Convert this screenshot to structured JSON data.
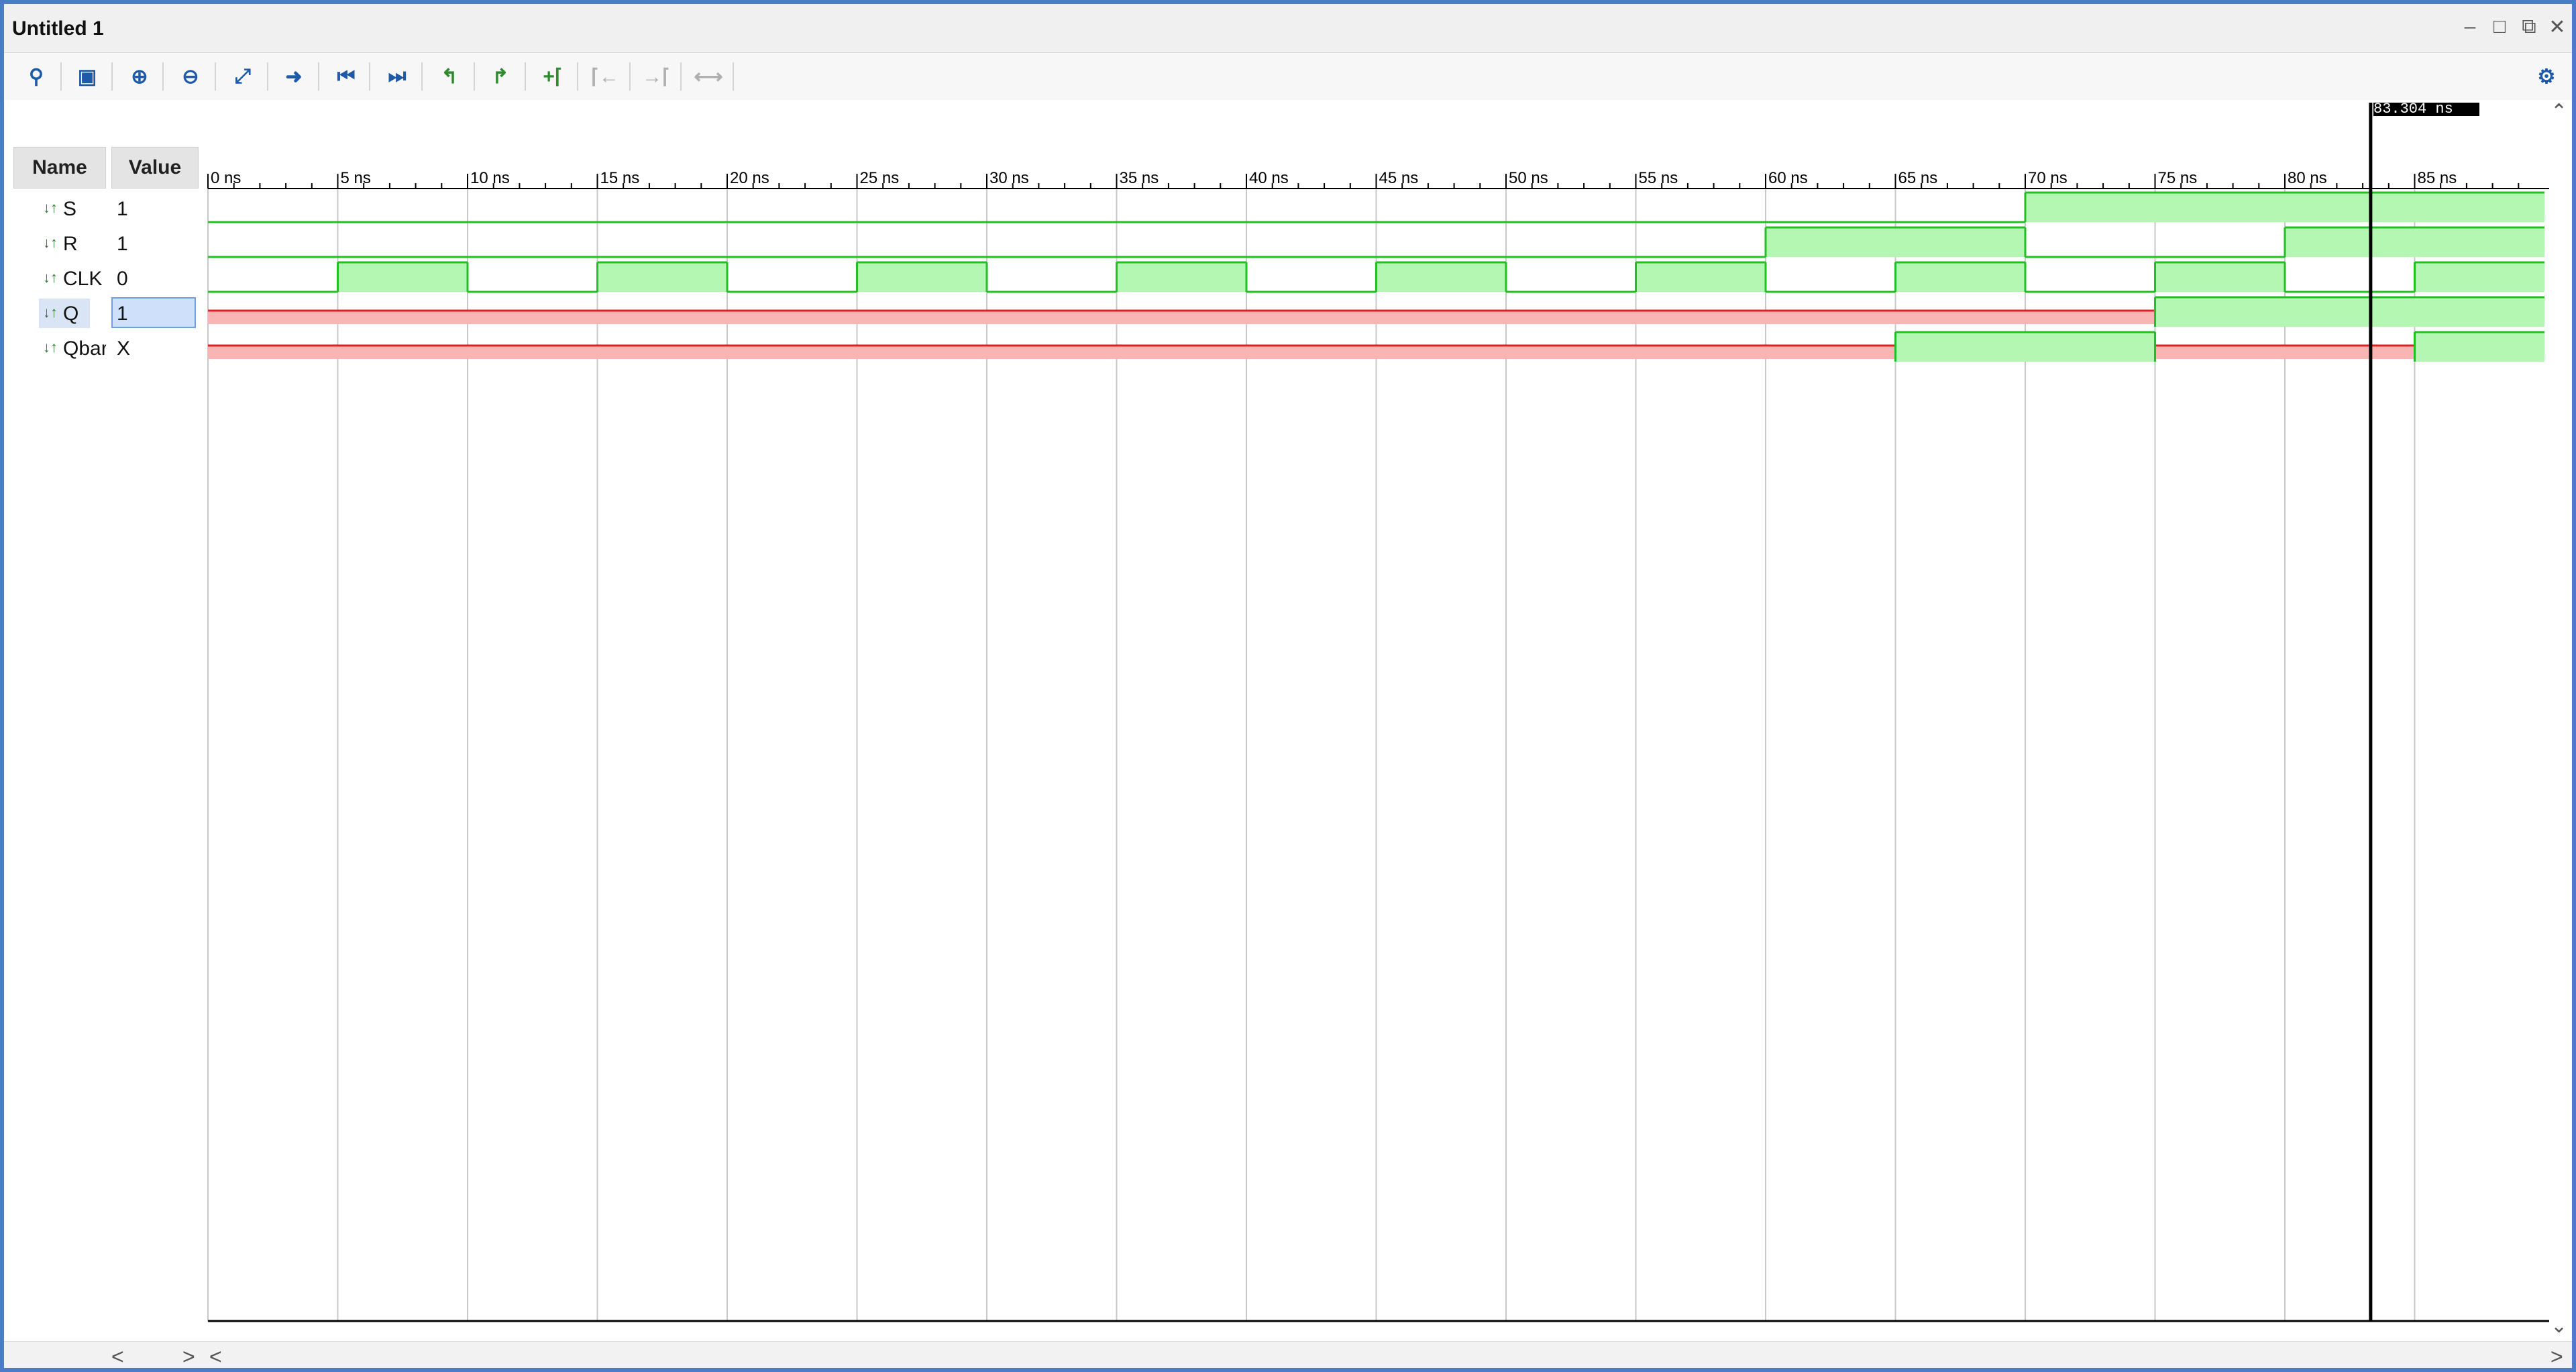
{
  "window": {
    "title": "Untitled 1"
  },
  "toolbar": {
    "buttons": [
      {
        "icon": "search-icon"
      },
      {
        "icon": "save-icon"
      },
      {
        "icon": "zoom-in-icon"
      },
      {
        "icon": "zoom-out-icon"
      },
      {
        "icon": "zoom-fit-icon"
      },
      {
        "icon": "go-to-cursor-icon"
      },
      {
        "icon": "go-to-start-icon"
      },
      {
        "icon": "go-to-end-icon"
      },
      {
        "icon": "previous-transition-icon"
      },
      {
        "icon": "next-transition-icon"
      },
      {
        "icon": "add-marker-icon"
      },
      {
        "icon": "previous-marker-icon"
      },
      {
        "icon": "next-marker-icon"
      },
      {
        "icon": "swap-cursors-icon"
      }
    ],
    "settings_icon": "gear-icon"
  },
  "columns": {
    "name": "Name",
    "value": "Value"
  },
  "signals": [
    {
      "name": "S",
      "value": "1"
    },
    {
      "name": "R",
      "value": "1"
    },
    {
      "name": "CLK",
      "value": "0"
    },
    {
      "name": "Q",
      "value": "1"
    },
    {
      "name": "Qbar",
      "value": "X"
    }
  ],
  "timeline": {
    "unit": "ns",
    "ticks": [
      "0 ns",
      "5 ns",
      "10 ns",
      "15 ns",
      "20 ns",
      "25 ns",
      "30 ns",
      "35 ns",
      "40 ns",
      "45 ns",
      "50 ns",
      "55 ns",
      "60 ns",
      "65 ns",
      "70 ns",
      "75 ns",
      "80 ns",
      "85 ns"
    ],
    "cursor_time": 83.304,
    "cursor_label": "83.304 ns"
  },
  "colors": {
    "high": "#b3f7b3",
    "line": "#22c022",
    "unknown": "#f9b4b4",
    "unknown_line": "#e02020"
  },
  "waveforms": {
    "S": [
      [
        0,
        70,
        "0"
      ],
      [
        70,
        90,
        "1"
      ]
    ],
    "R": [
      [
        0,
        60,
        "0"
      ],
      [
        60,
        70,
        "1"
      ],
      [
        70,
        80,
        "0"
      ],
      [
        80,
        90,
        "1"
      ]
    ],
    "CLK": [
      [
        0,
        5,
        "0"
      ],
      [
        5,
        10,
        "1"
      ],
      [
        10,
        15,
        "0"
      ],
      [
        15,
        20,
        "1"
      ],
      [
        20,
        25,
        "0"
      ],
      [
        25,
        30,
        "1"
      ],
      [
        30,
        35,
        "0"
      ],
      [
        35,
        40,
        "1"
      ],
      [
        40,
        45,
        "0"
      ],
      [
        45,
        50,
        "1"
      ],
      [
        50,
        55,
        "0"
      ],
      [
        55,
        60,
        "1"
      ],
      [
        60,
        65,
        "0"
      ],
      [
        65,
        70,
        "1"
      ],
      [
        70,
        75,
        "0"
      ],
      [
        75,
        80,
        "1"
      ],
      [
        80,
        85,
        "0"
      ],
      [
        85,
        90,
        "1"
      ]
    ],
    "Q": [
      [
        0,
        75,
        "X"
      ],
      [
        75,
        90,
        "1"
      ]
    ],
    "Qbar": [
      [
        0,
        65,
        "X"
      ],
      [
        65,
        75,
        "1"
      ],
      [
        75,
        85,
        "X"
      ],
      [
        85,
        90,
        "1"
      ]
    ]
  }
}
